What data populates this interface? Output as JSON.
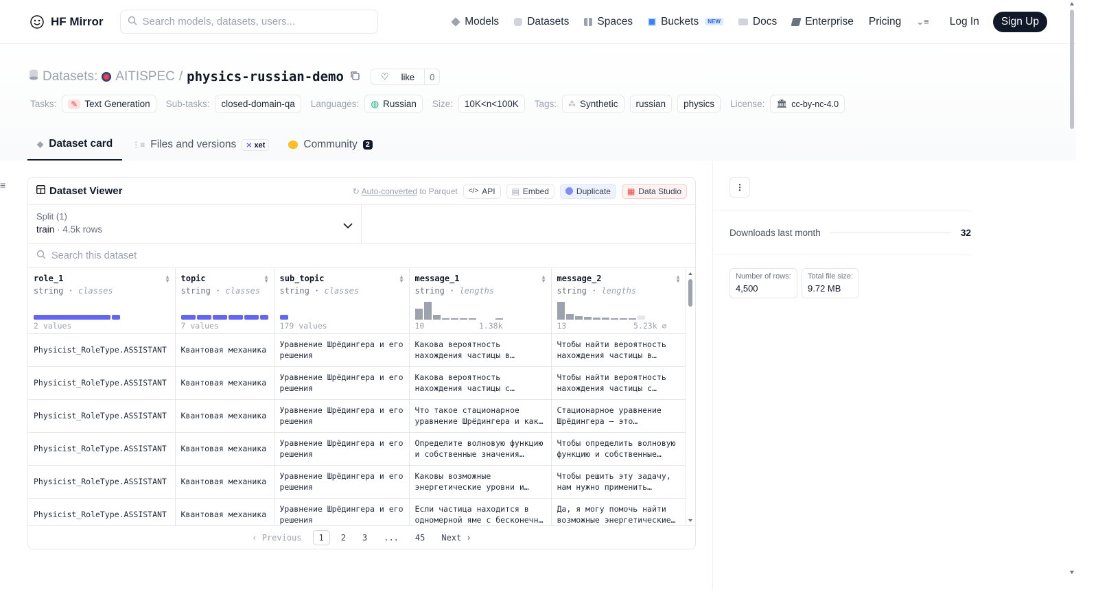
{
  "header": {
    "logo_text": "HF Mirror",
    "search_placeholder": "Search models, datasets, users...",
    "nav": [
      {
        "label": "Models",
        "icon": "models-icon"
      },
      {
        "label": "Datasets",
        "icon": "datasets-icon"
      },
      {
        "label": "Spaces",
        "icon": "spaces-icon"
      },
      {
        "label": "Buckets",
        "icon": "buckets-icon",
        "badge": "NEW"
      },
      {
        "label": "Docs",
        "icon": "docs-icon"
      },
      {
        "label": "Enterprise",
        "icon": "enterprise-icon"
      },
      {
        "label": "Pricing"
      }
    ],
    "login": "Log In",
    "signup": "Sign Up"
  },
  "repo": {
    "prefix": "Datasets:",
    "org": "AITISPEC",
    "sep": "/",
    "name": "physics-russian-demo",
    "like_label": "like",
    "like_count": "0"
  },
  "tags": {
    "tasks_label": "Tasks:",
    "task": "Text Generation",
    "subtasks_label": "Sub-tasks:",
    "subtask": "closed-domain-qa",
    "languages_label": "Languages:",
    "language": "Russian",
    "size_label": "Size:",
    "size": "10K<n<100K",
    "tags_label": "Tags:",
    "tag1": "Synthetic",
    "tag2": "russian",
    "tag3": "physics",
    "license_label": "License:",
    "license": "cc-by-nc-4.0"
  },
  "tabs": {
    "card": "Dataset card",
    "files": "Files and versions",
    "xet": "xet",
    "community": "Community",
    "community_count": "2"
  },
  "viewer": {
    "title": "Dataset Viewer",
    "auto_converted": "Auto-converted",
    "to_parquet": "to Parquet",
    "api": "API",
    "embed": "Embed",
    "duplicate": "Duplicate",
    "data_studio": "Data Studio",
    "split_label": "Split (1)",
    "split_name": "train",
    "split_rows": "4.5k rows",
    "search_placeholder": "Search this dataset",
    "columns": [
      {
        "name": "role_1",
        "type": "string",
        "kind": "classes",
        "summary_left": "2 values",
        "summary_right": ""
      },
      {
        "name": "topic",
        "type": "string",
        "kind": "classes",
        "summary_left": "7 values",
        "summary_right": ""
      },
      {
        "name": "sub_topic",
        "type": "string",
        "kind": "classes",
        "summary_left": "179 values",
        "summary_right": ""
      },
      {
        "name": "message_1",
        "type": "string",
        "kind": "lengths",
        "summary_left": "10",
        "summary_right": "1.38k"
      },
      {
        "name": "message_2",
        "type": "string",
        "kind": "lengths",
        "summary_left": "13",
        "summary_right": "5.23k ⌀"
      }
    ],
    "rows": [
      [
        "Physicist_RoleType.ASSISTANT",
        "Квантовая механика",
        "Уравнение Шрёдингера и его решения",
        "Какова вероятность нахождения частицы в…",
        "Чтобы найти вероятность нахождения частицы в…"
      ],
      [
        "Physicist_RoleType.ASSISTANT",
        "Квантовая механика",
        "Уравнение Шрёдингера и его решения",
        "Какова вероятность нахождения частицы с…",
        "Чтобы найти вероятность нахождения частицы с…"
      ],
      [
        "Physicist_RoleType.ASSISTANT",
        "Квантовая механика",
        "Уравнение Шрёдингера и его решения",
        "Что такое стационарное уравнение Шрёдингера и как…",
        "Стационарное уравнение Шрёдингера — это…"
      ],
      [
        "Physicist_RoleType.ASSISTANT",
        "Квантовая механика",
        "Уравнение Шрёдингера и его решения",
        "Определите волновую функцию и собственные значения…",
        "Чтобы определить волновую функцию и собственные…"
      ],
      [
        "Physicist_RoleType.ASSISTANT",
        "Квантовая механика",
        "Уравнение Шрёдингера и его решения",
        "Каковы возможные энергетические уровни и…",
        "Чтобы решить эту задачу, нам нужно применить…"
      ],
      [
        "Physicist_RoleType.ASSISTANT",
        "Квантовая механика",
        "Уравнение Шрёдингера и его решения",
        "Если частица находится в одномерной яме с бесконечн…",
        "Да, я могу помочь найти возможные энергетические…"
      ]
    ],
    "pager": {
      "prev": "Previous",
      "p1": "1",
      "p2": "2",
      "p3": "3",
      "ellipsis": "...",
      "last": "45",
      "next": "Next"
    }
  },
  "sidebar": {
    "downloads_label": "Downloads last month",
    "downloads_value": "32",
    "rows_label": "Number of rows:",
    "rows_value": "4,500",
    "size_label": "Total file size:",
    "size_value": "9.72 MB"
  },
  "colors": {
    "accent": "#6366f1",
    "primary_dark": "#111827",
    "muted": "#9ca3af"
  }
}
